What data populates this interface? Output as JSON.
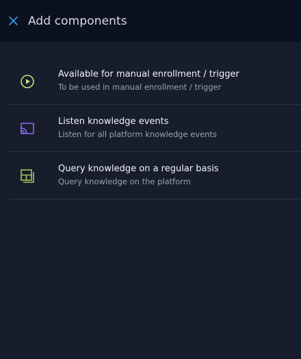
{
  "header": {
    "title": "Add components",
    "close_icon": "close-icon",
    "accent_color": "#2f9cdc"
  },
  "components": [
    {
      "icon": "play-circle-icon",
      "icon_color": "#c6e07c",
      "name": "Available for manual enrollment / trigger",
      "description": "To be used in manual enrollment / trigger"
    },
    {
      "icon": "cast-stream-icon",
      "icon_color": "#8b6cf0",
      "name": "Listen knowledge events",
      "description": "Listen for all platform knowledge events"
    },
    {
      "icon": "query-layout-icon",
      "icon_color": "#a3c75c",
      "name": "Query knowledge on a regular basis",
      "description": "Query knowledge on the platform"
    }
  ]
}
